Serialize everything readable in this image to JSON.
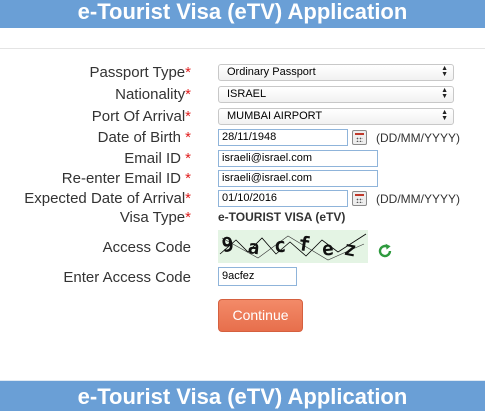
{
  "banner": {
    "title": "e-Tourist Visa (eTV) Application",
    "bottom_title": "e-Tourist Visa (eTV) Application"
  },
  "form": {
    "passport_type": {
      "label": "Passport Type",
      "value": "Ordinary Passport"
    },
    "nationality": {
      "label": "Nationality",
      "value": "ISRAEL"
    },
    "port_of_arrival": {
      "label": "Port Of Arrival",
      "value": "MUMBAI AIRPORT"
    },
    "date_of_birth": {
      "label": "Date of Birth",
      "value": "28/11/1948",
      "format": "(DD/MM/YYYY)"
    },
    "email": {
      "label": "Email ID",
      "value": "israeli@israel.com"
    },
    "email_confirm": {
      "label": "Re-enter Email ID",
      "value": "israeli@israel.com"
    },
    "expected_arrival": {
      "label": "Expected Date of Arrival",
      "value": "01/10/2016",
      "format": "(DD/MM/YYYY)"
    },
    "visa_type": {
      "label": "Visa Type",
      "value": "e-TOURIST VISA (eTV)"
    },
    "access_code": {
      "label": "Access Code",
      "captcha_text": "9acfez",
      "refresh_icon": "refresh-icon"
    },
    "enter_access_code": {
      "label": "Enter Access Code",
      "value": "9acfez"
    },
    "required_marker": "*",
    "continue_label": "Continue"
  },
  "colors": {
    "banner": "#6a9fd6",
    "required": "#e01e1e",
    "button": "#e76f4c",
    "captcha_bg": "#e4f4e4",
    "refresh": "#2e9a3e"
  }
}
